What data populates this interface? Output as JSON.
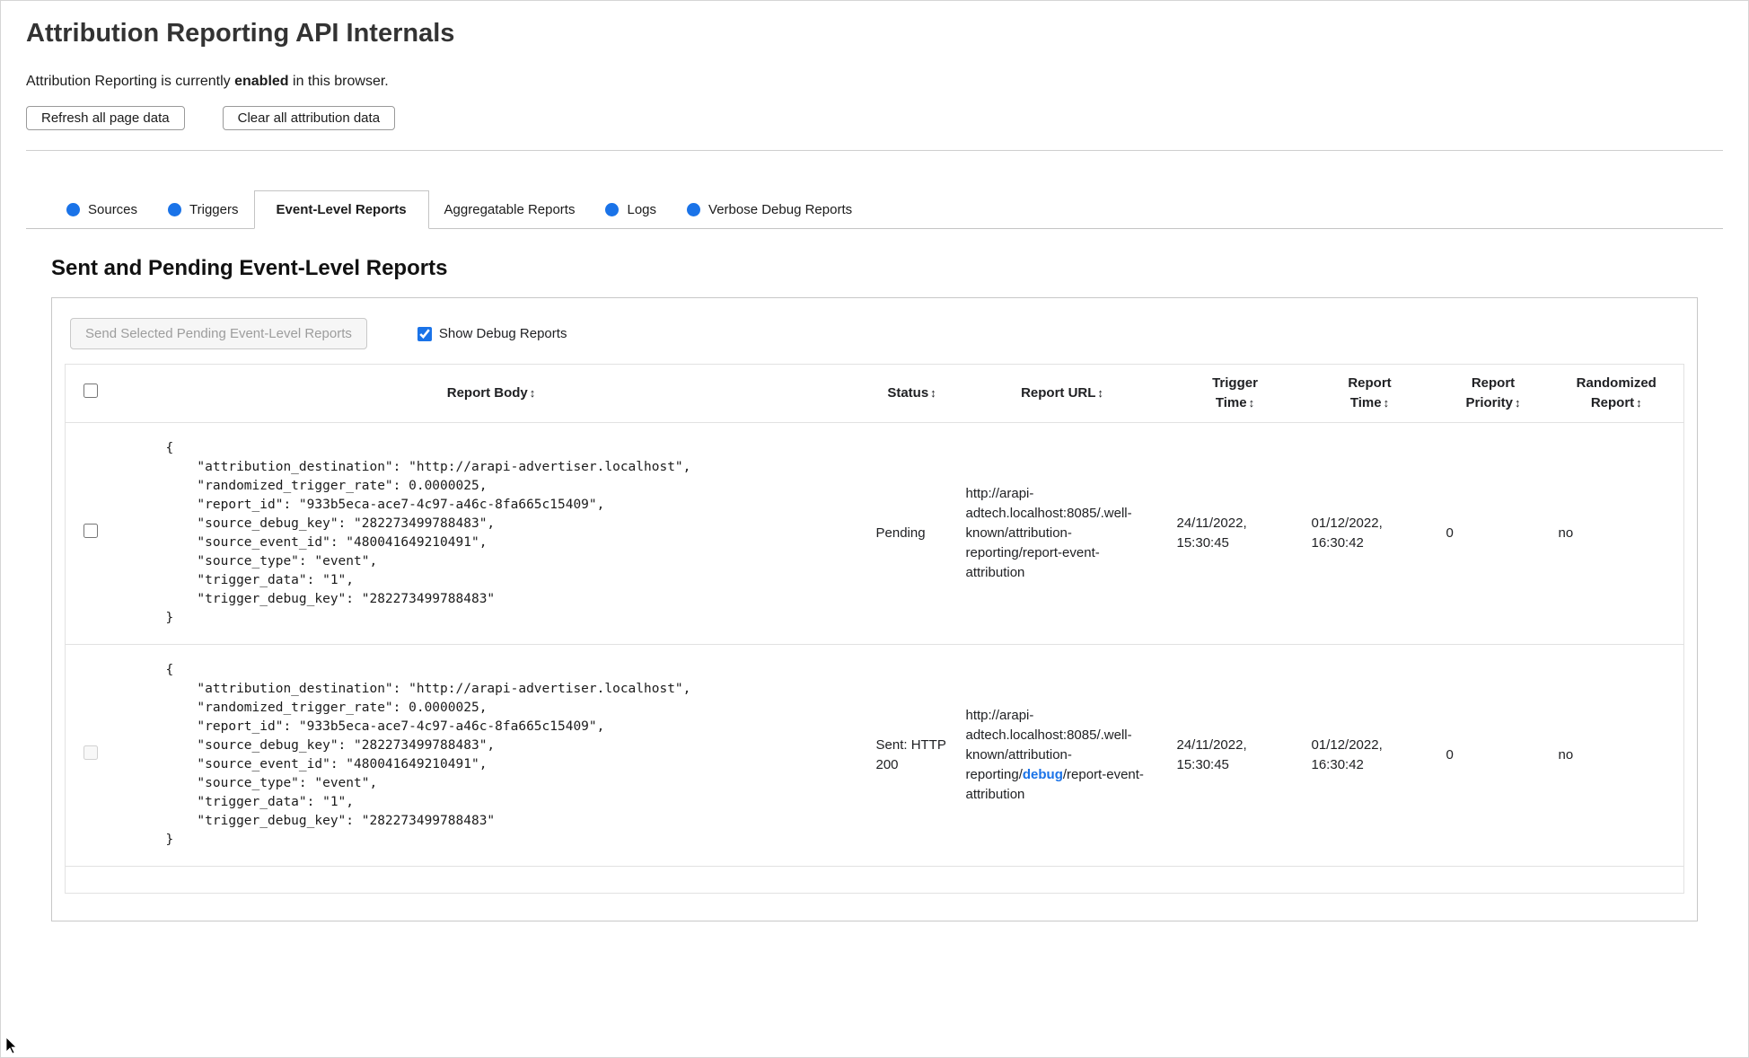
{
  "header": {
    "title": "Attribution Reporting API Internals",
    "status": {
      "prefix": "Attribution Reporting is currently ",
      "emphasis": "enabled",
      "suffix": " in this browser."
    },
    "buttons": {
      "refresh": "Refresh all page data",
      "clear": "Clear all attribution data"
    }
  },
  "tabs": {
    "items": [
      {
        "label": "Sources"
      },
      {
        "label": "Triggers"
      },
      {
        "label": "Event-Level Reports"
      },
      {
        "label": "Aggregatable Reports"
      },
      {
        "label": "Logs"
      },
      {
        "label": "Verbose Debug Reports"
      }
    ]
  },
  "section": {
    "heading": "Sent and Pending Event-Level Reports",
    "send_button": "Send Selected Pending Event-Level Reports",
    "show_debug_label": "Show Debug Reports"
  },
  "table": {
    "sort_icon": "↕",
    "headers": {
      "report_body": "Report Body",
      "status": "Status",
      "report_url": "Report URL",
      "trigger_time": "Trigger Time",
      "report_time": "Report Time",
      "report_priority": "Report Priority",
      "randomized_report": "Randomized Report"
    },
    "rows": [
      {
        "report_body": "{\n    \"attribution_destination\": \"http://arapi-advertiser.localhost\",\n    \"randomized_trigger_rate\": 0.0000025,\n    \"report_id\": \"933b5eca-ace7-4c97-a46c-8fa665c15409\",\n    \"source_debug_key\": \"282273499788483\",\n    \"source_event_id\": \"480041649210491\",\n    \"source_type\": \"event\",\n    \"trigger_data\": \"1\",\n    \"trigger_debug_key\": \"282273499788483\"\n}",
        "status": "Pending",
        "url_pre": "http://arapi-adtech.localhost:8085/.well-known/attribution-reporting/report-event-attribution",
        "url_debug": "",
        "url_post": "",
        "trigger_time": "24/11/2022, 15:30:45",
        "report_time": "01/12/2022, 16:30:42",
        "report_priority": "0",
        "randomized_report": "no"
      },
      {
        "report_body": "{\n    \"attribution_destination\": \"http://arapi-advertiser.localhost\",\n    \"randomized_trigger_rate\": 0.0000025,\n    \"report_id\": \"933b5eca-ace7-4c97-a46c-8fa665c15409\",\n    \"source_debug_key\": \"282273499788483\",\n    \"source_event_id\": \"480041649210491\",\n    \"source_type\": \"event\",\n    \"trigger_data\": \"1\",\n    \"trigger_debug_key\": \"282273499788483\"\n}",
        "status": "Sent: HTTP 200",
        "url_pre": "http://arapi-adtech.localhost:8085/.well-known/attribution-reporting/",
        "url_debug": "debug",
        "url_post": "/report-event-attribution",
        "trigger_time": "24/11/2022, 15:30:45",
        "report_time": "01/12/2022, 16:30:42",
        "report_priority": "0",
        "randomized_report": "no"
      }
    ]
  },
  "colors": {
    "accent_blue": "#1a73e8",
    "debug_link": "#1a73e8",
    "border_gray": "#c8c8c8"
  }
}
